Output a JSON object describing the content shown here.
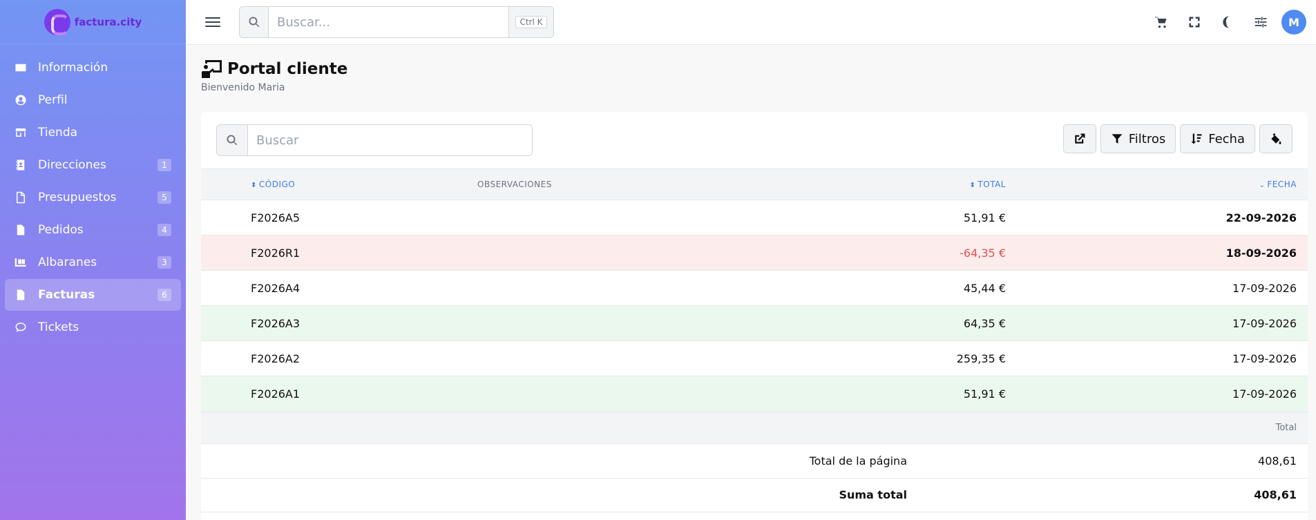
{
  "brand": {
    "name": "factura.city"
  },
  "sidebar": {
    "items": [
      {
        "label": "Información",
        "badge": "",
        "icon": "id-card-icon"
      },
      {
        "label": "Perfil",
        "badge": "",
        "icon": "user-circle-icon"
      },
      {
        "label": "Tienda",
        "badge": "",
        "icon": "store-icon"
      },
      {
        "label": "Direcciones",
        "badge": "1",
        "icon": "address-book-icon"
      },
      {
        "label": "Presupuestos",
        "badge": "5",
        "icon": "file-icon"
      },
      {
        "label": "Pedidos",
        "badge": "4",
        "icon": "file-invoice-icon"
      },
      {
        "label": "Albaranes",
        "badge": "3",
        "icon": "dolly-icon"
      },
      {
        "label": "Facturas",
        "badge": "6",
        "icon": "file-dollar-icon",
        "active": true
      },
      {
        "label": "Tickets",
        "badge": "",
        "icon": "comment-icon"
      }
    ]
  },
  "topbar": {
    "search_placeholder": "Buscar...",
    "shortcut": "Ctrl K",
    "avatar_initial": "M"
  },
  "page": {
    "title": "Portal cliente",
    "subtitle": "Bienvenido Maria"
  },
  "toolbar": {
    "search_placeholder": "Buscar",
    "filters_label": "Filtros",
    "sort_label": "Fecha"
  },
  "table": {
    "headers": {
      "code": "Código",
      "obs": "Observaciones",
      "total": "Total",
      "date": "Fecha"
    },
    "rows": [
      {
        "code": "F2026A5",
        "obs": "",
        "total": "51,91 €",
        "date": "22-09-2026",
        "state": "",
        "bold_date": true
      },
      {
        "code": "F2026R1",
        "obs": "",
        "total": "-64,35 €",
        "date": "18-09-2026",
        "state": "neg",
        "bold_date": true
      },
      {
        "code": "F2026A4",
        "obs": "",
        "total": "45,44 €",
        "date": "17-09-2026",
        "state": "",
        "bold_date": false
      },
      {
        "code": "F2026A3",
        "obs": "",
        "total": "64,35 €",
        "date": "17-09-2026",
        "state": "pos",
        "bold_date": false
      },
      {
        "code": "F2026A2",
        "obs": "",
        "total": "259,35 €",
        "date": "17-09-2026",
        "state": "",
        "bold_date": false
      },
      {
        "code": "F2026A1",
        "obs": "",
        "total": "51,91 €",
        "date": "17-09-2026",
        "state": "pos",
        "bold_date": false
      }
    ]
  },
  "summary": {
    "header": "Total",
    "page_total_label": "Total de la página",
    "page_total_value": "408,61",
    "grand_total_label": "Suma total",
    "grand_total_value": "408,61"
  },
  "colors": {
    "accent": "#3b7be8",
    "negative": "#e05252",
    "negative_bg": "#fdecec",
    "positive_bg": "#ebf8ee"
  }
}
